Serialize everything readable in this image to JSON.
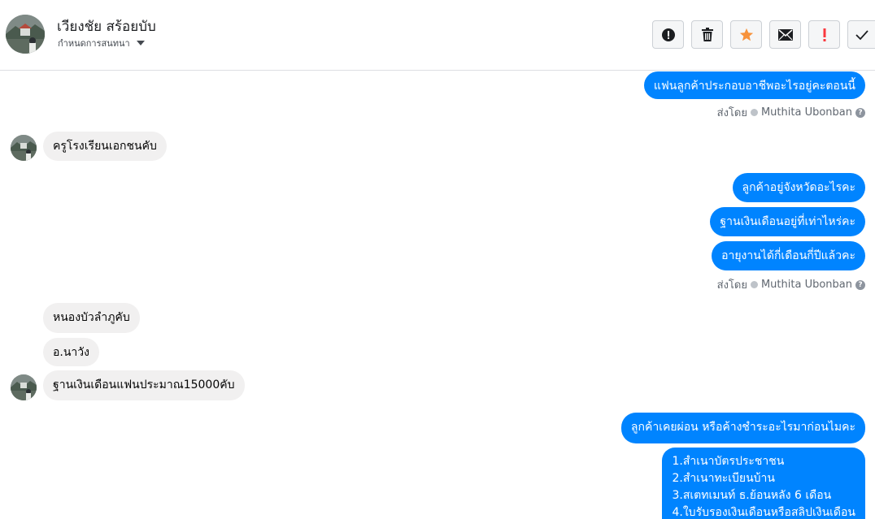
{
  "header": {
    "contact_name": "เวียงชัย สร้อยบับ",
    "subtitle": "กำหนดการสนทนา",
    "toolbar": [
      {
        "icon": "alert-circle-icon",
        "color": "#1c1e21"
      },
      {
        "icon": "trash-icon",
        "color": "#1c1e21"
      },
      {
        "icon": "star-icon",
        "color": "#f7923b"
      },
      {
        "icon": "envelope-icon",
        "color": "#1c1e21"
      },
      {
        "icon": "exclamation-icon",
        "color": "#fa383e"
      },
      {
        "icon": "check-icon",
        "color": "#1c1e21"
      }
    ]
  },
  "colors": {
    "outgoing_bubble": "#0084ff",
    "incoming_bubble": "#f1f0f0",
    "star": "#f7923b",
    "exclamation": "#fa383e"
  },
  "thread": {
    "msg1": "แฟนลูกค้าประกอบอาชีพอะไรอยู่คะตอนนี้",
    "sent_by_1": {
      "prefix": "ส่งโดย",
      "agent": "Muthita Ubonban"
    },
    "msg2": "ครูโรงเรียนเอกชนคับ",
    "msg3": "ลูกค้าอยู่จังหวัดอะไรคะ",
    "msg4": "ฐานเงินเดือนอยู่ที่เท่าไหร่คะ",
    "msg5": "อายุงานได้กี่เดือนกี่ปีแล้วคะ",
    "sent_by_2": {
      "prefix": "ส่งโดย",
      "agent": "Muthita Ubonban"
    },
    "msg6": "หนองบัวลำภูคับ",
    "msg7": "อ.นาวัง",
    "msg8": "ฐานเงินเดือนแฟนประมาณ15000คับ",
    "msg9": "ลูกค้าเคยผ่อน หรือค้างชำระอะไรมาก่อนไมคะ",
    "msg10_lines": [
      "1.สำเนาบัตรประชาชน",
      "2.สำเนาทะเบียนบ้าน",
      "3.สเตทเมนท์ ธ.ย้อนหลัง 6 เดือน",
      "4.ใบรับรองเงินเดือนหรือสลิปเงินเดือน"
    ]
  }
}
